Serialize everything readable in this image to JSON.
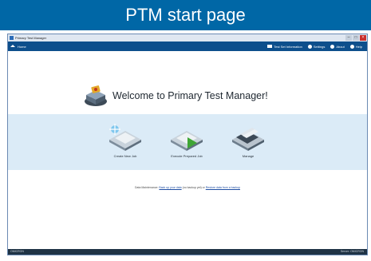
{
  "slide": {
    "title": "PTM start page"
  },
  "window": {
    "title": "Primary Test Manager",
    "controls": [
      "–",
      "□",
      "×"
    ]
  },
  "nav": {
    "home_label": "Home",
    "home_icon": "home-icon",
    "right_items": [
      {
        "label": "Test Set Information",
        "icon": "test-set-icon"
      },
      {
        "label": "Settings",
        "icon": "gear-icon"
      },
      {
        "label": "About",
        "icon": "info-icon"
      },
      {
        "label": "Help",
        "icon": "help-icon"
      }
    ],
    "bar_color": "#0d4f8c"
  },
  "welcome": {
    "text": "Welcome to Primary Test Manager!"
  },
  "actions": [
    {
      "label": "Create New Job",
      "icon": "create-job-icon"
    },
    {
      "label": "Execute Prepared Job",
      "icon": "execute-job-icon"
    },
    {
      "label": "Manage",
      "icon": "manage-icon"
    }
  ],
  "data_line": {
    "prefix": "Data Maintenance: ",
    "link1": "Back up your data",
    "middle": " (no backup yet) or ",
    "link2": "Restore data from a backup"
  },
  "status": {
    "left": "OMICRON",
    "right": "Server: OMICRON"
  },
  "colors": {
    "slide_header": "#0067a6",
    "band": "#dbebf7",
    "status_bar": "#1f3345"
  }
}
